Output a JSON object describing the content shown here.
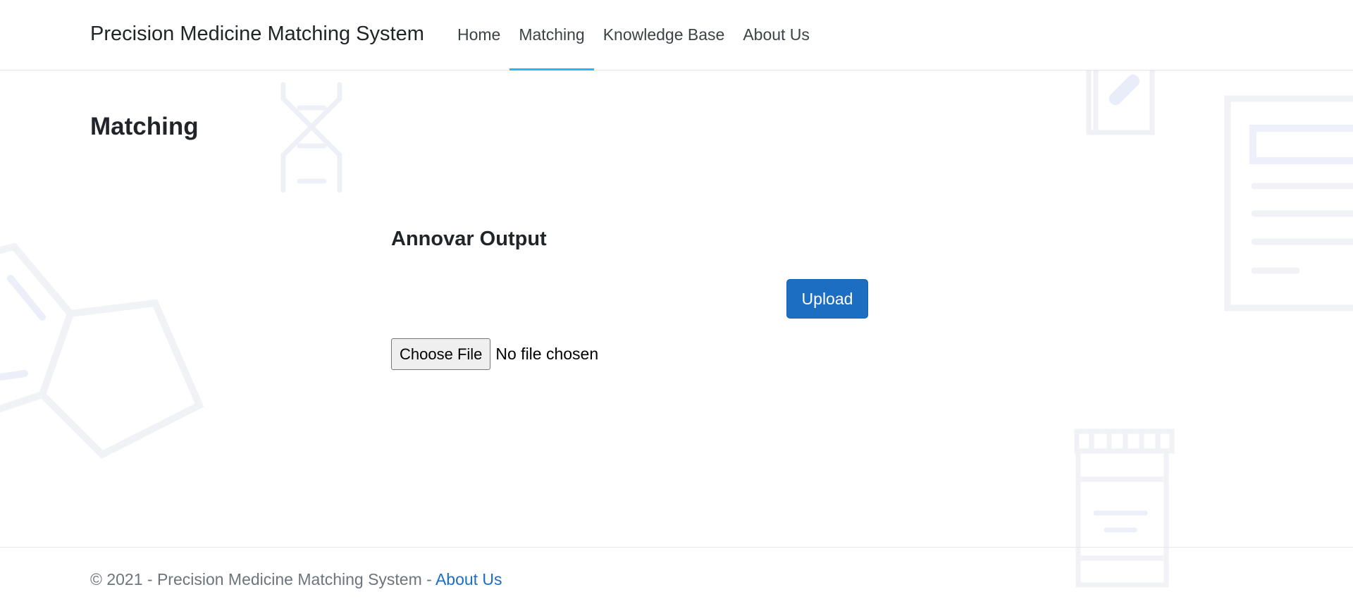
{
  "navbar": {
    "brand": "Precision Medicine Matching System",
    "links": [
      {
        "label": "Home",
        "active": false
      },
      {
        "label": "Matching",
        "active": true
      },
      {
        "label": "Knowledge Base",
        "active": false
      },
      {
        "label": "About Us",
        "active": false
      }
    ],
    "active_color": "#29b6f6"
  },
  "main": {
    "page_title": "Matching",
    "section_title": "Annovar Output",
    "upload_label": "Upload",
    "file_input": {
      "button_label": "Choose File",
      "status": "No file chosen"
    },
    "accent_color": "#1b6ec2"
  },
  "footer": {
    "copyright": "© 2021 - Precision Medicine Matching System - ",
    "link_label": "About Us"
  }
}
